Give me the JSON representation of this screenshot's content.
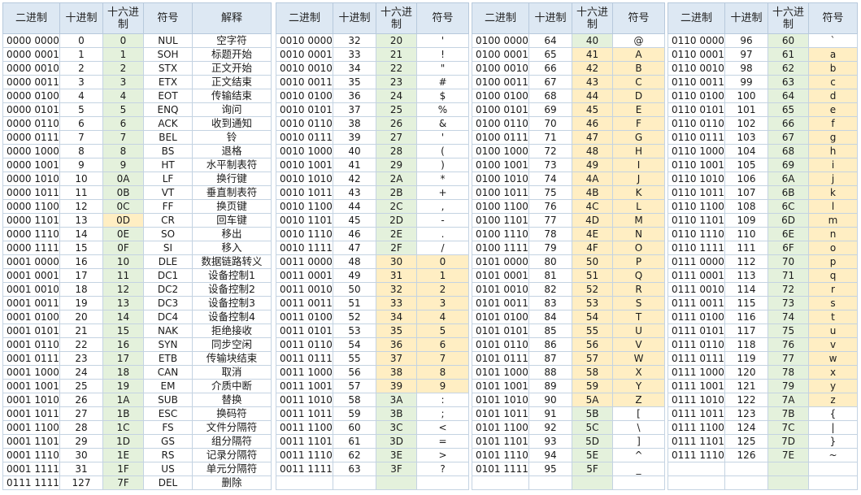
{
  "headers": {
    "binary": "二进制",
    "decimal": "十进制",
    "hex": "十六进制",
    "symbol": "符号",
    "meaning": "解释"
  },
  "panel1": [
    [
      "0000 0000",
      "0",
      "0",
      "NUL",
      "空字符"
    ],
    [
      "0000 0001",
      "1",
      "1",
      "SOH",
      "标题开始"
    ],
    [
      "0000 0010",
      "2",
      "2",
      "STX",
      "正文开始"
    ],
    [
      "0000 0011",
      "3",
      "3",
      "ETX",
      "正文结束"
    ],
    [
      "0000 0100",
      "4",
      "4",
      "EOT",
      "传输结束"
    ],
    [
      "0000 0101",
      "5",
      "5",
      "ENQ",
      "询问"
    ],
    [
      "0000 0110",
      "6",
      "6",
      "ACK",
      "收到通知"
    ],
    [
      "0000 0111",
      "7",
      "7",
      "BEL",
      "铃"
    ],
    [
      "0000 1000",
      "8",
      "8",
      "BS",
      "退格"
    ],
    [
      "0000 1001",
      "9",
      "9",
      "HT",
      "水平制表符"
    ],
    [
      "0000 1010",
      "10",
      "0A",
      "LF",
      "换行键"
    ],
    [
      "0000 1011",
      "11",
      "0B",
      "VT",
      "垂直制表符"
    ],
    [
      "0000 1100",
      "12",
      "0C",
      "FF",
      "换页键"
    ],
    [
      "0000 1101",
      "13",
      "0D",
      "CR",
      "回车键"
    ],
    [
      "0000 1110",
      "14",
      "0E",
      "SO",
      "移出"
    ],
    [
      "0000 1111",
      "15",
      "0F",
      "SI",
      "移入"
    ],
    [
      "0001 0000",
      "16",
      "10",
      "DLE",
      "数据链路转义"
    ],
    [
      "0001 0001",
      "17",
      "11",
      "DC1",
      "设备控制1"
    ],
    [
      "0001 0010",
      "18",
      "12",
      "DC2",
      "设备控制2"
    ],
    [
      "0001 0011",
      "19",
      "13",
      "DC3",
      "设备控制3"
    ],
    [
      "0001 0100",
      "20",
      "14",
      "DC4",
      "设备控制4"
    ],
    [
      "0001 0101",
      "21",
      "15",
      "NAK",
      "拒绝接收"
    ],
    [
      "0001 0110",
      "22",
      "16",
      "SYN",
      "同步空闲"
    ],
    [
      "0001 0111",
      "23",
      "17",
      "ETB",
      "传输块结束"
    ],
    [
      "0001 1000",
      "24",
      "18",
      "CAN",
      "取消"
    ],
    [
      "0001 1001",
      "25",
      "19",
      "EM",
      "介质中断"
    ],
    [
      "0001 1010",
      "26",
      "1A",
      "SUB",
      "替换"
    ],
    [
      "0001 1011",
      "27",
      "1B",
      "ESC",
      "换码符"
    ],
    [
      "0001 1100",
      "28",
      "1C",
      "FS",
      "文件分隔符"
    ],
    [
      "0001 1101",
      "29",
      "1D",
      "GS",
      "组分隔符"
    ],
    [
      "0001 1110",
      "30",
      "1E",
      "RS",
      "记录分隔符"
    ],
    [
      "0001 1111",
      "31",
      "1F",
      "US",
      "单元分隔符"
    ],
    [
      "0111 1111",
      "127",
      "7F",
      "DEL",
      "删除"
    ]
  ],
  "panel2": [
    [
      "0010 0000",
      "32",
      "20",
      "'"
    ],
    [
      "0010 0001",
      "33",
      "21",
      "!"
    ],
    [
      "0010 0010",
      "34",
      "22",
      "\""
    ],
    [
      "0010 0011",
      "35",
      "23",
      "#"
    ],
    [
      "0010 0100",
      "36",
      "24",
      "$"
    ],
    [
      "0010 0101",
      "37",
      "25",
      "%"
    ],
    [
      "0010 0110",
      "38",
      "26",
      "&"
    ],
    [
      "0010 0111",
      "39",
      "27",
      "'"
    ],
    [
      "0010 1000",
      "40",
      "28",
      "("
    ],
    [
      "0010 1001",
      "41",
      "29",
      ")"
    ],
    [
      "0010 1010",
      "42",
      "2A",
      "*"
    ],
    [
      "0010 1011",
      "43",
      "2B",
      "+"
    ],
    [
      "0010 1100",
      "44",
      "2C",
      ","
    ],
    [
      "0010 1101",
      "45",
      "2D",
      "-"
    ],
    [
      "0010 1110",
      "46",
      "2E",
      "."
    ],
    [
      "0010 1111",
      "47",
      "2F",
      "/"
    ],
    [
      "0011 0000",
      "48",
      "30",
      "0"
    ],
    [
      "0011 0001",
      "49",
      "31",
      "1"
    ],
    [
      "0011 0010",
      "50",
      "32",
      "2"
    ],
    [
      "0011 0011",
      "51",
      "33",
      "3"
    ],
    [
      "0011 0100",
      "52",
      "34",
      "4"
    ],
    [
      "0011 0101",
      "53",
      "35",
      "5"
    ],
    [
      "0011 0110",
      "54",
      "36",
      "6"
    ],
    [
      "0011 0111",
      "55",
      "37",
      "7"
    ],
    [
      "0011 1000",
      "56",
      "38",
      "8"
    ],
    [
      "0011 1001",
      "57",
      "39",
      "9"
    ],
    [
      "0011 1010",
      "58",
      "3A",
      ":"
    ],
    [
      "0011 1011",
      "59",
      "3B",
      ";"
    ],
    [
      "0011 1100",
      "60",
      "3C",
      "<"
    ],
    [
      "0011 1101",
      "61",
      "3D",
      "="
    ],
    [
      "0011 1110",
      "62",
      "3E",
      ">"
    ],
    [
      "0011 1111",
      "63",
      "3F",
      "?"
    ]
  ],
  "panel3": [
    [
      "0100 0000",
      "64",
      "40",
      "@"
    ],
    [
      "0100 0001",
      "65",
      "41",
      "A"
    ],
    [
      "0100 0010",
      "66",
      "42",
      "B"
    ],
    [
      "0100 0011",
      "67",
      "43",
      "C"
    ],
    [
      "0100 0100",
      "68",
      "44",
      "D"
    ],
    [
      "0100 0101",
      "69",
      "45",
      "E"
    ],
    [
      "0100 0110",
      "70",
      "46",
      "F"
    ],
    [
      "0100 0111",
      "71",
      "47",
      "G"
    ],
    [
      "0100 1000",
      "72",
      "48",
      "H"
    ],
    [
      "0100 1001",
      "73",
      "49",
      "I"
    ],
    [
      "0100 1010",
      "74",
      "4A",
      "J"
    ],
    [
      "0100 1011",
      "75",
      "4B",
      "K"
    ],
    [
      "0100 1100",
      "76",
      "4C",
      "L"
    ],
    [
      "0100 1101",
      "77",
      "4D",
      "M"
    ],
    [
      "0100 1110",
      "78",
      "4E",
      "N"
    ],
    [
      "0100 1111",
      "79",
      "4F",
      "O"
    ],
    [
      "0101 0000",
      "80",
      "50",
      "P"
    ],
    [
      "0101 0001",
      "81",
      "51",
      "Q"
    ],
    [
      "0101 0010",
      "82",
      "52",
      "R"
    ],
    [
      "0101 0011",
      "83",
      "53",
      "S"
    ],
    [
      "0101 0100",
      "84",
      "54",
      "T"
    ],
    [
      "0101 0101",
      "85",
      "55",
      "U"
    ],
    [
      "0101 0110",
      "86",
      "56",
      "V"
    ],
    [
      "0101 0111",
      "87",
      "57",
      "W"
    ],
    [
      "0101 1000",
      "88",
      "58",
      "X"
    ],
    [
      "0101 1001",
      "89",
      "59",
      "Y"
    ],
    [
      "0101 1010",
      "90",
      "5A",
      "Z"
    ],
    [
      "0101 1011",
      "91",
      "5B",
      "["
    ],
    [
      "0101 1100",
      "92",
      "5C",
      "\\"
    ],
    [
      "0101 1101",
      "93",
      "5D",
      "]"
    ],
    [
      "0101 1110",
      "94",
      "5E",
      "^"
    ],
    [
      "0101 1111",
      "95",
      "5F",
      "_"
    ]
  ],
  "panel4": [
    [
      "0110 0000",
      "96",
      "60",
      "`"
    ],
    [
      "0110 0001",
      "97",
      "61",
      "a"
    ],
    [
      "0110 0010",
      "98",
      "62",
      "b"
    ],
    [
      "0110 0011",
      "99",
      "63",
      "c"
    ],
    [
      "0110 0100",
      "100",
      "64",
      "d"
    ],
    [
      "0110 0101",
      "101",
      "65",
      "e"
    ],
    [
      "0110 0110",
      "102",
      "66",
      "f"
    ],
    [
      "0110 0111",
      "103",
      "67",
      "g"
    ],
    [
      "0110 1000",
      "104",
      "68",
      "h"
    ],
    [
      "0110 1001",
      "105",
      "69",
      "i"
    ],
    [
      "0110 1010",
      "106",
      "6A",
      "j"
    ],
    [
      "0110 1011",
      "107",
      "6B",
      "k"
    ],
    [
      "0110 1100",
      "108",
      "6C",
      "l"
    ],
    [
      "0110 1101",
      "109",
      "6D",
      "m"
    ],
    [
      "0110 1110",
      "110",
      "6E",
      "n"
    ],
    [
      "0110 1111",
      "111",
      "6F",
      "o"
    ],
    [
      "0111 0000",
      "112",
      "70",
      "p"
    ],
    [
      "0111 0001",
      "113",
      "71",
      "q"
    ],
    [
      "0111 0010",
      "114",
      "72",
      "r"
    ],
    [
      "0111 0011",
      "115",
      "73",
      "s"
    ],
    [
      "0111 0100",
      "116",
      "74",
      "t"
    ],
    [
      "0111 0101",
      "117",
      "75",
      "u"
    ],
    [
      "0111 0110",
      "118",
      "76",
      "v"
    ],
    [
      "0111 0111",
      "119",
      "77",
      "w"
    ],
    [
      "0111 1000",
      "120",
      "78",
      "x"
    ],
    [
      "0111 1001",
      "121",
      "79",
      "y"
    ],
    [
      "0111 1010",
      "122",
      "7A",
      "z"
    ],
    [
      "0111 1011",
      "123",
      "7B",
      "{"
    ],
    [
      "0111 1100",
      "124",
      "7C",
      "|"
    ],
    [
      "0111 1101",
      "125",
      "7D",
      "}"
    ],
    [
      "0111 1110",
      "126",
      "7E",
      "~"
    ]
  ]
}
